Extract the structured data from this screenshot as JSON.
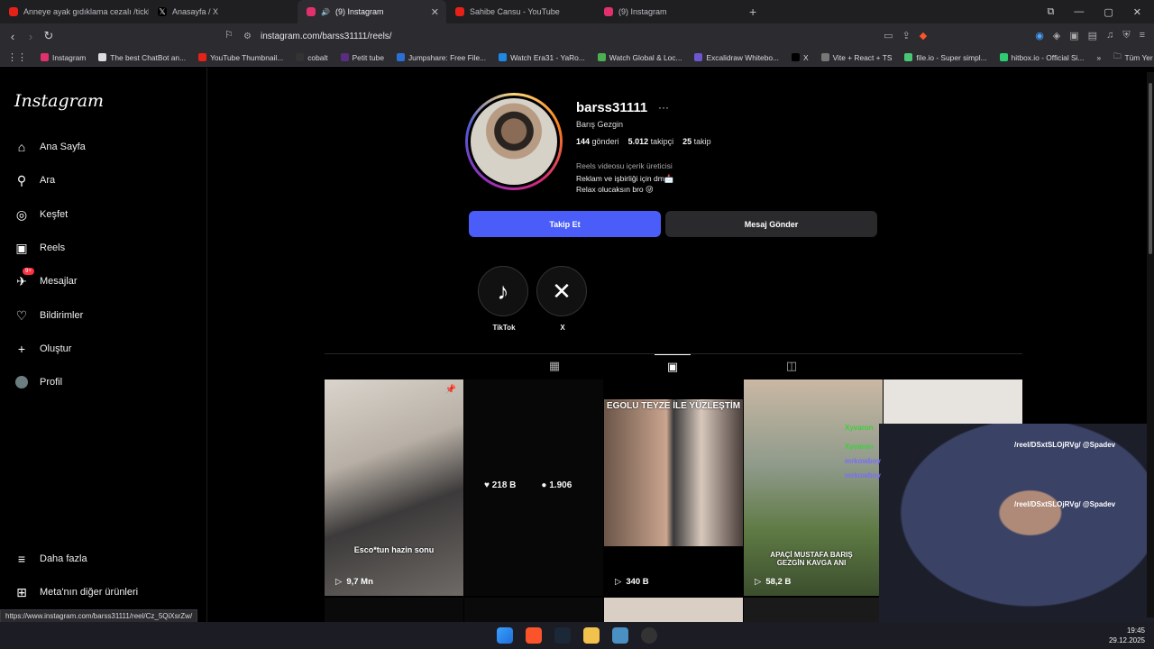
{
  "browser": {
    "tabs": [
      {
        "title": "Anneye ayak gıdıklama cezalı /tickle",
        "color": "#e62117"
      },
      {
        "title": "Anasayfa / X",
        "color": "#ffffff"
      },
      {
        "title": "(9) Instagram",
        "color": "#e1306c",
        "active": true
      },
      {
        "title": "Sahibe Cansu - YouTube",
        "color": "#e62117"
      },
      {
        "title": "(9) Instagram",
        "color": "#e1306c"
      }
    ],
    "url": "instagram.com/barss31111/reels/",
    "bookmarks": [
      "Instagram",
      "The best ChatBot an...",
      "YouTube Thumbnail...",
      "cobalt",
      "Petit tube",
      "Jumpshare: Free File...",
      "Watch Era31 - YaRo...",
      "Watch Global & Loc...",
      "Excalidraw Whitebo...",
      "X",
      "Vite + React + TS",
      "file.io - Super simpl...",
      "hitbox.io - Official Si..."
    ],
    "bookmarks_folder": "Tüm Yer İşaretleri",
    "status_url": "https://www.instagram.com/barss31111/reel/Cz_5QiXsrZw/"
  },
  "sidebar": {
    "logo": "Instagram",
    "items": [
      {
        "label": "Ana Sayfa",
        "icon": "home-icon",
        "glyph": "⌂"
      },
      {
        "label": "Ara",
        "icon": "search-icon",
        "glyph": "⚲"
      },
      {
        "label": "Keşfet",
        "icon": "compass-icon",
        "glyph": "◎"
      },
      {
        "label": "Reels",
        "icon": "reels-icon",
        "glyph": "▣"
      },
      {
        "label": "Mesajlar",
        "icon": "messenger-icon",
        "glyph": "✈"
      },
      {
        "label": "Bildirimler",
        "icon": "heart-icon",
        "glyph": "♡"
      },
      {
        "label": "Oluştur",
        "icon": "plus-icon",
        "glyph": "+"
      },
      {
        "label": "Profil",
        "icon": "avatar-icon",
        "glyph": "●"
      }
    ],
    "messages_badge": "9+",
    "more": "Daha fazla",
    "meta": "Meta'nın diğer ürünleri"
  },
  "profile": {
    "username": "barss31111",
    "full_name": "Barış Gezgin",
    "posts": "144",
    "posts_label": "gönderi",
    "followers": "5.012",
    "followers_label": "takipçi",
    "following": "25",
    "following_label": "takip",
    "category": "Reels videosu içerik üreticisi",
    "bio_line1": "Reklam ve işbirliği için dm📩",
    "bio_line2": "Relax olucaksın bro 😜",
    "follow_button": "Takip Et",
    "message_button": "Mesaj Gönder",
    "highlights": [
      {
        "label": "TikTok"
      },
      {
        "label": "X"
      }
    ]
  },
  "reels": [
    {
      "views": "9,7 Mn",
      "caption": "Esco*tun hazin sonu",
      "pinned": true
    },
    {
      "likes": "218 B",
      "comments": "1.906",
      "hover": true
    },
    {
      "views": "340 B",
      "caption": "EGOLU TEYZE İLE YÜZLEŞTİM"
    },
    {
      "views": "58,2 B",
      "caption": "APAÇİ MUSTAFA BARIŞ GEZGİN KAVGA ANI"
    }
  ],
  "overlay_chat": [
    {
      "text": "Xyvaron",
      "color": "#3ad13a"
    },
    {
      "text": "Xyvaron",
      "color": "#3ad13a"
    },
    {
      "text": "mrkowboy",
      "color": "#7a6cff"
    },
    {
      "text": "mrkowboy",
      "color": "#7a6cff"
    }
  ],
  "overlay_text": "/reel/DSxtSLOjRVg/ @Spadev",
  "clock": {
    "time": "19:45",
    "date": "29.12.2025"
  }
}
